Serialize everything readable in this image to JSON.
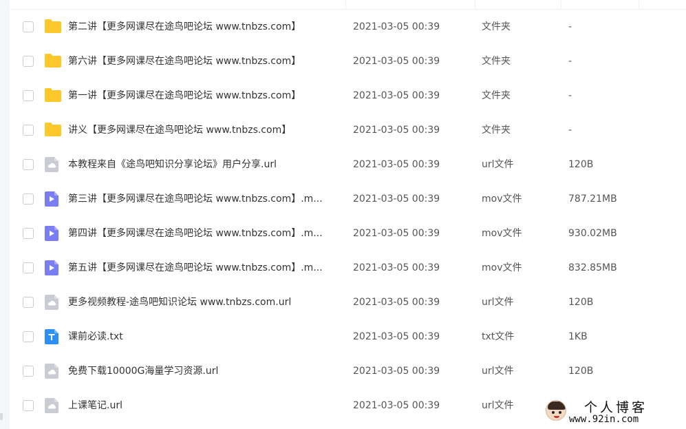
{
  "files": [
    {
      "icon": "folder-icon",
      "name": "第二讲【更多网课尽在途鸟吧论坛 www.tnbzs.com】",
      "time": "2021-03-05 00:39",
      "type": "文件夹",
      "size": "-"
    },
    {
      "icon": "folder-icon",
      "name": "第六讲【更多网课尽在途鸟吧论坛 www.tnbzs.com】",
      "time": "2021-03-05 00:39",
      "type": "文件夹",
      "size": "-"
    },
    {
      "icon": "folder-icon",
      "name": "第一讲【更多网课尽在途鸟吧论坛 www.tnbzs.com】",
      "time": "2021-03-05 00:39",
      "type": "文件夹",
      "size": "-"
    },
    {
      "icon": "folder-icon",
      "name": "讲义【更多网课尽在途鸟吧论坛 www.tnbzs.com】",
      "time": "2021-03-05 00:39",
      "type": "文件夹",
      "size": "-"
    },
    {
      "icon": "url-file-icon",
      "name": "本教程来自《途鸟吧知识分享论坛》用户分享.url",
      "time": "2021-03-05 00:39",
      "type": "url文件",
      "size": "120B"
    },
    {
      "icon": "video-file-icon",
      "name": "第三讲【更多网课尽在途鸟吧论坛 www.tnbzs.com】.m...",
      "time": "2021-03-05 00:39",
      "type": "mov文件",
      "size": "787.21MB"
    },
    {
      "icon": "video-file-icon",
      "name": "第四讲【更多网课尽在途鸟吧论坛 www.tnbzs.com】.m...",
      "time": "2021-03-05 00:39",
      "type": "mov文件",
      "size": "930.02MB"
    },
    {
      "icon": "video-file-icon",
      "name": "第五讲【更多网课尽在途鸟吧论坛 www.tnbzs.com】.m...",
      "time": "2021-03-05 00:39",
      "type": "mov文件",
      "size": "832.85MB"
    },
    {
      "icon": "url-file-icon",
      "name": "更多视频教程-途鸟吧知识论坛 www.tnbzs.com.url",
      "time": "2021-03-05 00:39",
      "type": "url文件",
      "size": "120B"
    },
    {
      "icon": "text-file-icon",
      "name": "课前必读.txt",
      "time": "2021-03-05 00:39",
      "type": "txt文件",
      "size": "1KB"
    },
    {
      "icon": "url-file-icon",
      "name": "免费下载10000G海量学习资源.url",
      "time": "2021-03-05 00:39",
      "type": "url文件",
      "size": "120B"
    },
    {
      "icon": "url-file-icon",
      "name": "上课笔记.url",
      "time": "2021-03-05 00:39",
      "type": "url文件",
      "size": ""
    }
  ],
  "watermark": {
    "title": "个人博客",
    "url": "www.92in.com"
  },
  "colors": {
    "folder": "#fcc82b",
    "video": "#7b7ef2",
    "text_file": "#2b8ff5",
    "url_file": "#c9ccd2"
  }
}
